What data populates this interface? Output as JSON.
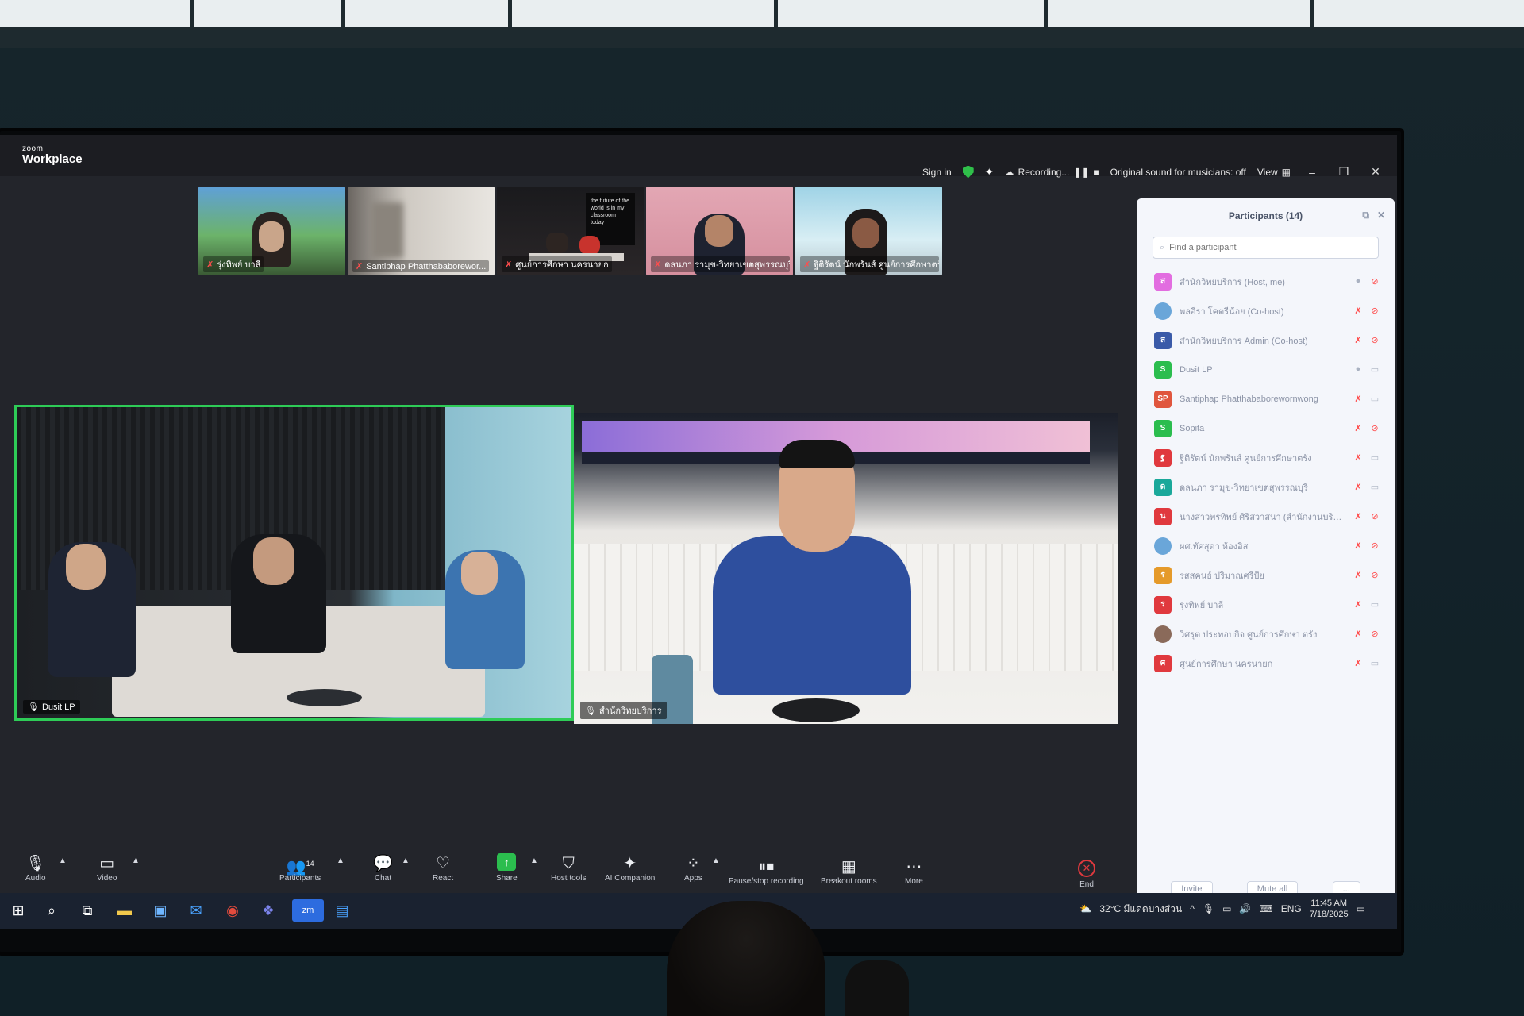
{
  "titlebar": {
    "brand_small": "zoom",
    "brand": "Workplace",
    "sign_in": "Sign in",
    "recording": "Recording...",
    "original_sound": "Original sound for musicians: off",
    "view": "View"
  },
  "thumbnails": [
    {
      "name": "รุ่งทิพย์ บาลี"
    },
    {
      "name": "Santiphap Phatthababorewor..."
    },
    {
      "name": "ศูนย์การศึกษา นครนายก",
      "board_text": "the future of the world is in my classroom today"
    },
    {
      "name": "ดลนภา รามุข-วิทยาเขตสุพรรณบุรี"
    },
    {
      "name": "ฐิติรัตน์ นักพร้นส์ ศูนย์การศึกษาตรั..."
    }
  ],
  "main_tiles": {
    "left_name": "Dusit LP",
    "right_name": "สำนักวิทยบริการ"
  },
  "participants_panel": {
    "title": "Participants (14)",
    "search_placeholder": "Find a participant",
    "invite": "Invite",
    "mute_all": "Mute all",
    "more": "...",
    "items": [
      {
        "initial": "ส",
        "name": "สำนักวิทยบริการ (Host, me)",
        "color": "#e26de0",
        "mic": "on",
        "cam": "off"
      },
      {
        "initial": "",
        "name": "พลอีรา โคตรีน้อย (Co-host)",
        "color": "#6aa6d9",
        "mic": "muted",
        "cam": "off"
      },
      {
        "initial": "ส",
        "name": "สำนักวิทยบริการ Admin (Co-host)",
        "color": "#3a5aa8",
        "mic": "muted",
        "cam": "off"
      },
      {
        "initial": "S",
        "name": "Dusit LP",
        "color": "#2bbd4e",
        "mic": "on",
        "cam": "on"
      },
      {
        "initial": "SP",
        "name": "Santiphap Phatthababorewornwong",
        "color": "#e0563e",
        "mic": "muted",
        "cam": "on"
      },
      {
        "initial": "S",
        "name": "Sopita",
        "color": "#2bbd4e",
        "mic": "muted",
        "cam": "off"
      },
      {
        "initial": "ฐ",
        "name": "ฐิติรัตน์ นักพร้นส์ ศูนย์การศึกษาตรัง",
        "color": "#e0393e",
        "mic": "muted",
        "cam": "on"
      },
      {
        "initial": "ด",
        "name": "ดลนภา รามุข-วิทยาเขตสุพรรณบุรี",
        "color": "#1aa89a",
        "mic": "muted",
        "cam": "on"
      },
      {
        "initial": "น",
        "name": "นางสาวพรทิพย์ ศิริสวาสนา (สำนักงานบริการ...",
        "color": "#e0393e",
        "mic": "muted",
        "cam": "off"
      },
      {
        "initial": "",
        "name": "ผศ.ทัศสุดา ห้องอิส",
        "color": "#6aa6d9",
        "mic": "muted",
        "cam": "off"
      },
      {
        "initial": "ร",
        "name": "รสสคนธ์ ปริมาณศรีปัย",
        "color": "#e59a2a",
        "mic": "muted",
        "cam": "off"
      },
      {
        "initial": "ร",
        "name": "รุ่งทิพย์ บาลี",
        "color": "#e0393e",
        "mic": "muted",
        "cam": "on"
      },
      {
        "initial": "",
        "name": "วิศรุต ประทอบกิจ ศูนย์การศึกษา ตรัง",
        "color": "#8a6a5a",
        "mic": "muted",
        "cam": "off"
      },
      {
        "initial": "ศ",
        "name": "ศูนย์การศึกษา นครนายก",
        "color": "#e0393e",
        "mic": "muted",
        "cam": "on"
      }
    ]
  },
  "toolbar": {
    "audio": "Audio",
    "video": "Video",
    "participants": "Participants",
    "participants_count": "14",
    "chat": "Chat",
    "react": "React",
    "share": "Share",
    "host_tools": "Host tools",
    "ai_companion": "AI Companion",
    "apps": "Apps",
    "pause_recording": "Pause/stop recording",
    "breakout_rooms": "Breakout rooms",
    "more": "More",
    "end": "End"
  },
  "taskbar": {
    "zoom_app": "zm",
    "weather": "32°C มีแดดบางส่วน",
    "lang": "ENG",
    "time": "11:45 AM",
    "date": "7/18/2025"
  },
  "colors": {
    "active_speaker_border": "#2ecc57",
    "panel_bg": "#f4f6fb",
    "muted_red": "#ff4d4d",
    "share_green": "#2bbd4e",
    "end_red": "#e0393e"
  }
}
